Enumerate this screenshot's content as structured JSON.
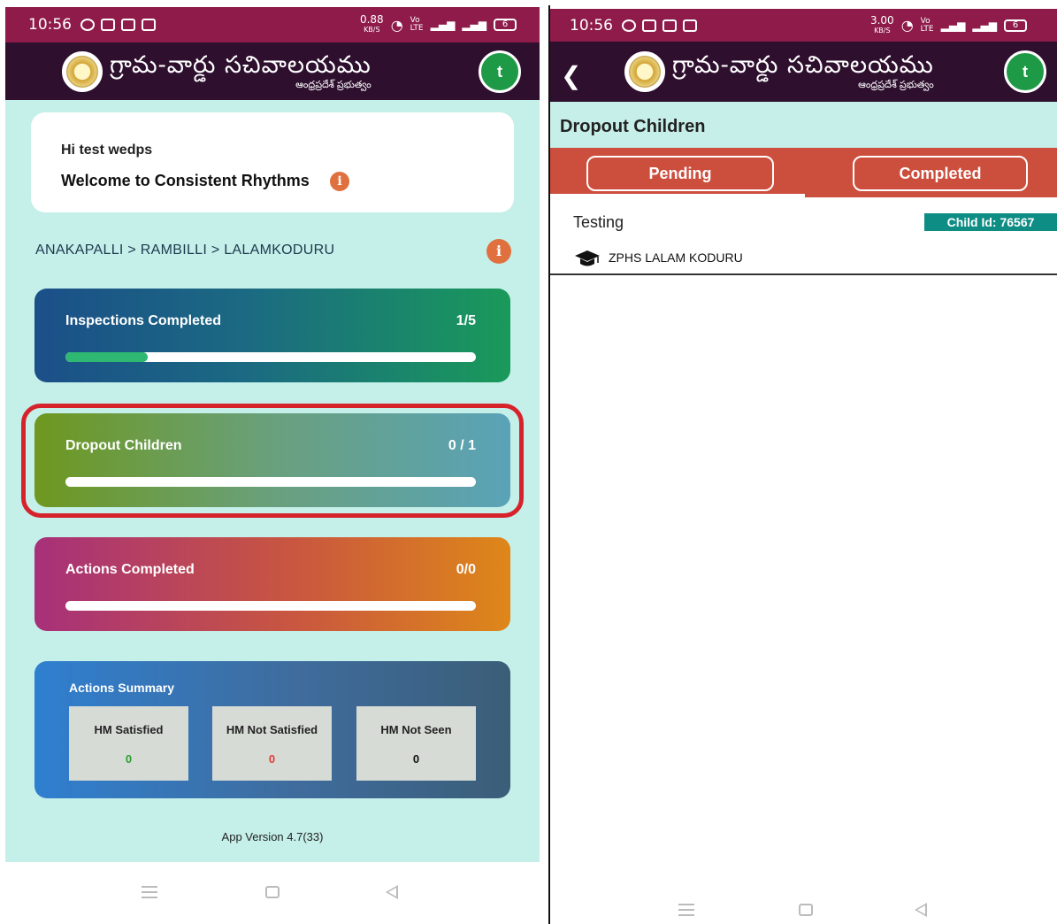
{
  "left_screen": {
    "status_bar": {
      "time": "10:56",
      "net_speed": "0.88",
      "net_unit": "KB/S",
      "battery": "6"
    },
    "app_bar": {
      "brand_title": "గ్రామ-వార్డు సచివాలయము",
      "brand_subtitle": "ఆంధ్రప్రదేశ్ ప్రభుత్వం",
      "avatar_initial": "t"
    },
    "welcome": {
      "greeting": "Hi test wedps",
      "message": "Welcome to Consistent Rhythms",
      "info_glyph": "i"
    },
    "breadcrumb": {
      "path": "ANAKAPALLI > RAMBILLI > LALAMKODURU",
      "info_glyph": "i"
    },
    "cards": [
      {
        "label": "Inspections Completed",
        "count": "1/5",
        "progress": 0.2
      },
      {
        "label": "Dropout Children",
        "count": "0 / 1",
        "progress": 0
      },
      {
        "label": "Actions Completed",
        "count": "0/0",
        "progress": 0
      }
    ],
    "summary": {
      "title": "Actions Summary",
      "items": [
        {
          "label": "HM Satisfied",
          "value": "0",
          "color": "#2ca02c"
        },
        {
          "label": "HM Not Satisfied",
          "value": "0",
          "color": "#e53935"
        },
        {
          "label": "HM Not Seen",
          "value": "0",
          "color": "#111111"
        }
      ]
    },
    "app_version": "App Version  4.7(33)",
    "highlight_color": "#d6232b"
  },
  "right_screen": {
    "status_bar": {
      "time": "10:56",
      "net_speed": "3.00",
      "net_unit": "KB/S",
      "battery": "6"
    },
    "app_bar": {
      "brand_title": "గ్రామ-వార్డు సచివాలయము",
      "brand_subtitle": "ఆంధ్రప్రదేశ్ ప్రభుత్వం",
      "avatar_initial": "t",
      "back_icon": "chevron-left-icon"
    },
    "page_title": "Dropout Children",
    "tabs": {
      "pending": "Pending",
      "completed": "Completed",
      "active": "pending"
    },
    "records": [
      {
        "name": "Testing",
        "child_id": "Child Id: 76567",
        "school": "ZPHS LALAM KODURU"
      }
    ]
  }
}
